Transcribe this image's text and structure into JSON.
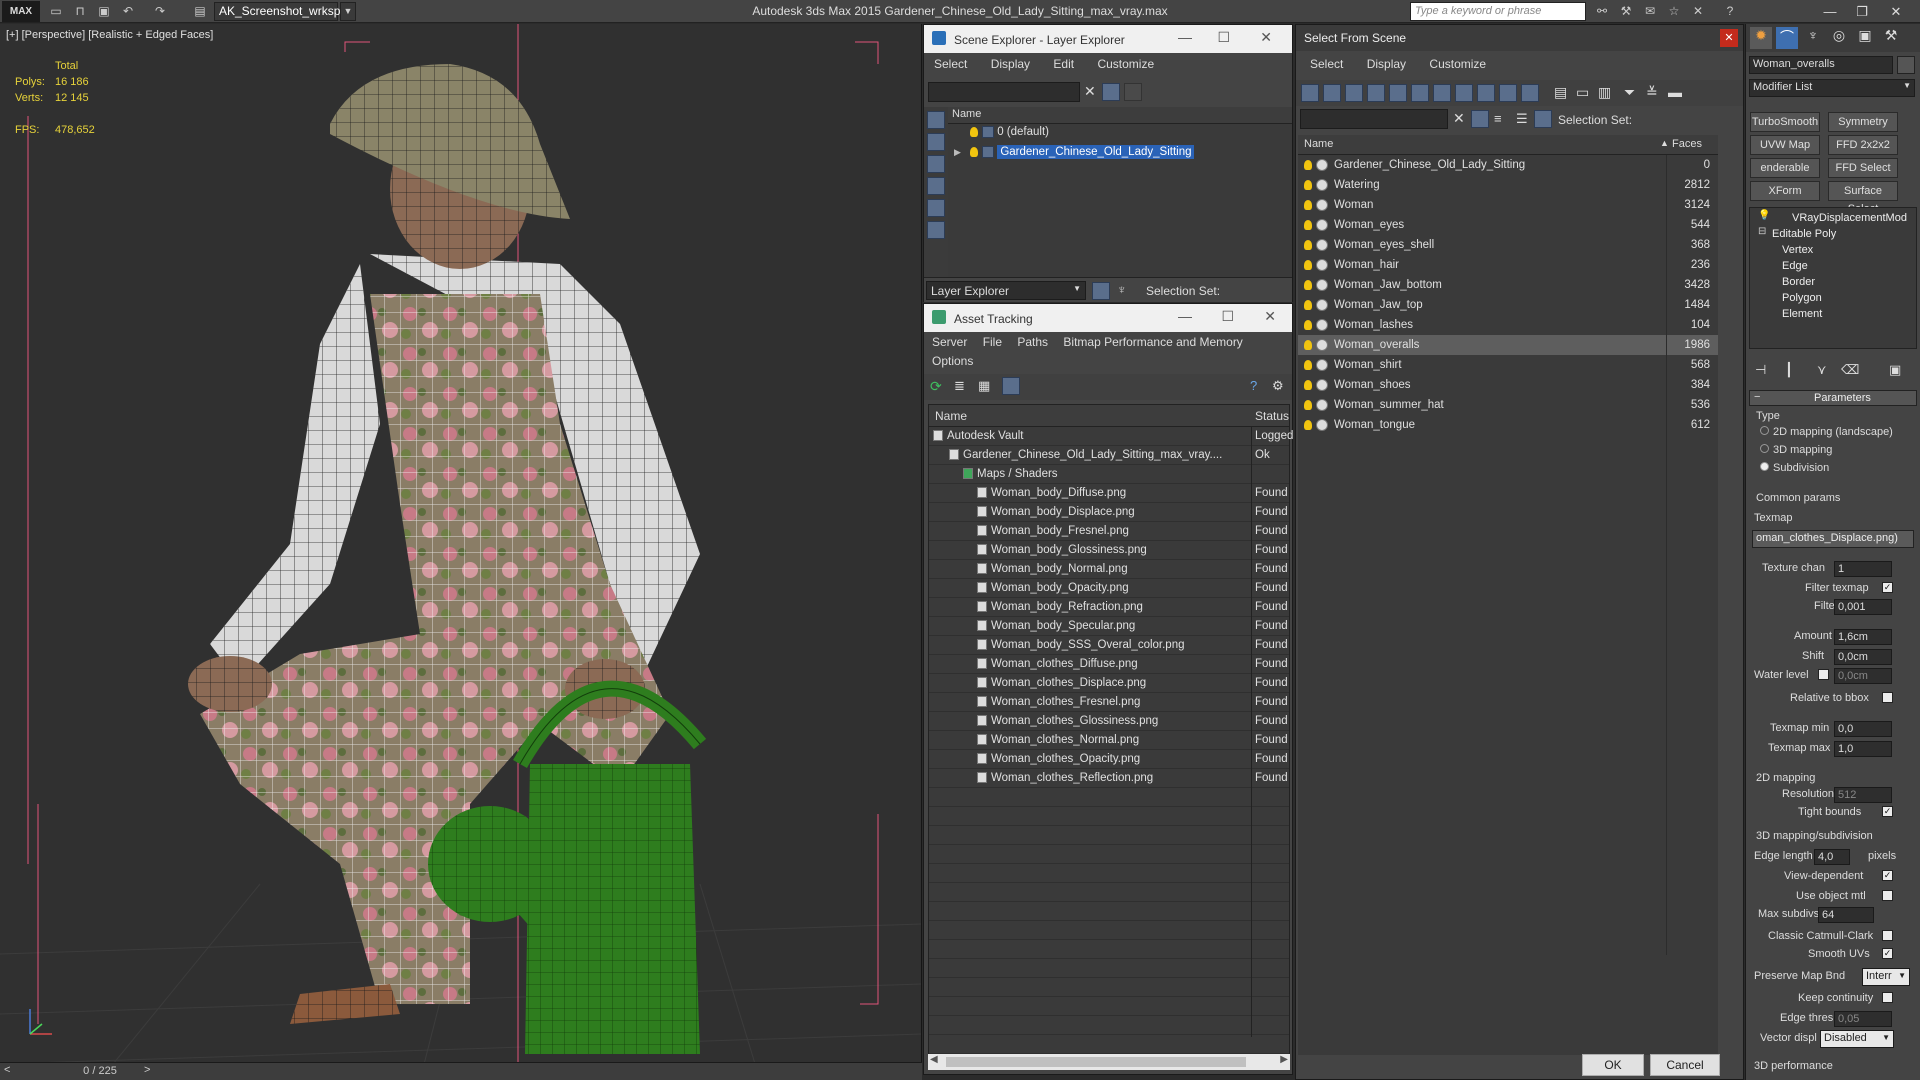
{
  "titlebar": {
    "logo": "MAX",
    "workspace": "AK_Screenshot_wrksp",
    "app_title": "Autodesk 3ds Max  2015    Gardener_Chinese_Old_Lady_Sitting_max_vray.max",
    "search_placeholder": "Type a keyword or phrase"
  },
  "viewport": {
    "label": "[+] [Perspective] [Realistic + Edged Faces]",
    "stats": {
      "total_label": "Total",
      "polys_label": "Polys:",
      "polys_value": "16 186",
      "verts_label": "Verts:",
      "verts_value": "12 145",
      "fps_label": "FPS:",
      "fps_value": "478,652"
    },
    "timeline": "0 / 225",
    "timeline_prev": "<",
    "timeline_next": ">"
  },
  "scene_explorer": {
    "title": "Scene Explorer - Layer Explorer",
    "menu": [
      "Select",
      "Display",
      "Edit",
      "Customize"
    ],
    "column_name": "Name",
    "layers": [
      {
        "label": "0 (default)",
        "selected": false
      },
      {
        "label": "Gardener_Chinese_Old_Lady_Sitting",
        "selected": true
      }
    ],
    "footer_mode": "Layer Explorer",
    "selection_set_label": "Selection Set:"
  },
  "asset_tracking": {
    "title": "Asset Tracking",
    "menu": [
      "Server",
      "File",
      "Paths",
      "Bitmap Performance and Memory"
    ],
    "menu2": "Options",
    "columns": [
      "Name",
      "Status"
    ],
    "rows": [
      {
        "name": "Autodesk Vault",
        "status": "Logged",
        "level": 1
      },
      {
        "name": "Gardener_Chinese_Old_Lady_Sitting_max_vray....",
        "status": "Ok",
        "level": 2
      },
      {
        "name": "Maps / Shaders",
        "status": "",
        "level": 3
      },
      {
        "name": "Woman_body_Diffuse.png",
        "status": "Found",
        "level": 4
      },
      {
        "name": "Woman_body_Displace.png",
        "status": "Found",
        "level": 4
      },
      {
        "name": "Woman_body_Fresnel.png",
        "status": "Found",
        "level": 4
      },
      {
        "name": "Woman_body_Glossiness.png",
        "status": "Found",
        "level": 4
      },
      {
        "name": "Woman_body_Normal.png",
        "status": "Found",
        "level": 4
      },
      {
        "name": "Woman_body_Opacity.png",
        "status": "Found",
        "level": 4
      },
      {
        "name": "Woman_body_Refraction.png",
        "status": "Found",
        "level": 4
      },
      {
        "name": "Woman_body_Specular.png",
        "status": "Found",
        "level": 4
      },
      {
        "name": "Woman_body_SSS_Overal_color.png",
        "status": "Found",
        "level": 4
      },
      {
        "name": "Woman_clothes_Diffuse.png",
        "status": "Found",
        "level": 4
      },
      {
        "name": "Woman_clothes_Displace.png",
        "status": "Found",
        "level": 4
      },
      {
        "name": "Woman_clothes_Fresnel.png",
        "status": "Found",
        "level": 4
      },
      {
        "name": "Woman_clothes_Glossiness.png",
        "status": "Found",
        "level": 4
      },
      {
        "name": "Woman_clothes_Normal.png",
        "status": "Found",
        "level": 4
      },
      {
        "name": "Woman_clothes_Opacity.png",
        "status": "Found",
        "level": 4
      },
      {
        "name": "Woman_clothes_Reflection.png",
        "status": "Found",
        "level": 4
      }
    ]
  },
  "select_from_scene": {
    "title": "Select From Scene",
    "menu": [
      "Select",
      "Display",
      "Customize"
    ],
    "selection_set_label": "Selection Set:",
    "columns": [
      "Name",
      "Faces"
    ],
    "rows": [
      {
        "name": "Gardener_Chinese_Old_Lady_Sitting",
        "faces": "0",
        "selected": false
      },
      {
        "name": "Watering",
        "faces": "2812",
        "selected": false
      },
      {
        "name": "Woman",
        "faces": "3124",
        "selected": false
      },
      {
        "name": "Woman_eyes",
        "faces": "544",
        "selected": false
      },
      {
        "name": "Woman_eyes_shell",
        "faces": "368",
        "selected": false
      },
      {
        "name": "Woman_hair",
        "faces": "236",
        "selected": false
      },
      {
        "name": "Woman_Jaw_bottom",
        "faces": "3428",
        "selected": false
      },
      {
        "name": "Woman_Jaw_top",
        "faces": "1484",
        "selected": false
      },
      {
        "name": "Woman_lashes",
        "faces": "104",
        "selected": false
      },
      {
        "name": "Woman_overalls",
        "faces": "1986",
        "selected": true
      },
      {
        "name": "Woman_shirt",
        "faces": "568",
        "selected": false
      },
      {
        "name": "Woman_shoes",
        "faces": "384",
        "selected": false
      },
      {
        "name": "Woman_summer_hat",
        "faces": "536",
        "selected": false
      },
      {
        "name": "Woman_tongue",
        "faces": "612",
        "selected": false
      }
    ],
    "ok_label": "OK",
    "cancel_label": "Cancel"
  },
  "command_panel": {
    "object_name": "Woman_overalls",
    "modifier_list": "Modifier List",
    "modifier_buttons": [
      "TurboSmooth",
      "Symmetry",
      "UVW Map",
      "FFD 2x2x2",
      "enderable Splir",
      "FFD Select",
      "XForm",
      "Surface Select"
    ],
    "stack": [
      "VRayDisplacementMod",
      "Editable Poly",
      "Vertex",
      "Edge",
      "Border",
      "Polygon",
      "Element"
    ],
    "parameters_title": "Parameters",
    "type_label": "Type",
    "type_options": [
      "2D mapping (landscape)",
      "3D mapping",
      "Subdivision"
    ],
    "type_selected": 2,
    "common_params": "Common params",
    "texmap_label": "Texmap",
    "texmap_value": "oman_clothes_Displace.png)",
    "texture_chan_label": "Texture chan",
    "texture_chan_value": "1",
    "filter_texmap_label": "Filter texmap",
    "filter_blur_label": "Filter blur",
    "filter_blur_value": "0,001",
    "amount_label": "Amount",
    "amount_value": "1,6cm",
    "shift_label": "Shift",
    "shift_value": "0,0cm",
    "water_level_label": "Water level",
    "water_level_value": "0,0cm",
    "relative_bbox_label": "Relative to bbox",
    "texmap_min_label": "Texmap min",
    "texmap_min_value": "0,0",
    "texmap_max_label": "Texmap max",
    "texmap_max_value": "1,0",
    "mapping2d_label": "2D mapping",
    "resolution_label": "Resolution",
    "resolution_value": "512",
    "tight_bounds_label": "Tight bounds",
    "mapping3d_label": "3D mapping/subdivision",
    "edge_length_label": "Edge length",
    "edge_length_value": "4,0",
    "pixels_label": "pixels",
    "view_dependent_label": "View-dependent",
    "use_object_mtl_label": "Use object mtl",
    "max_subdivs_label": "Max subdivs",
    "max_subdivs_value": "64",
    "classic_cc_label": "Classic Catmull-Clark",
    "smooth_uvs_label": "Smooth UVs",
    "preserve_map_label": "Preserve Map Bnd",
    "preserve_map_value": "Interr",
    "keep_continuity_label": "Keep continuity",
    "edge_thresh_label": "Edge thresh",
    "edge_thresh_value": "0,05",
    "vector_displ_label": "Vector displ",
    "vector_displ_value": "Disabled",
    "perf_label": "3D performance"
  }
}
